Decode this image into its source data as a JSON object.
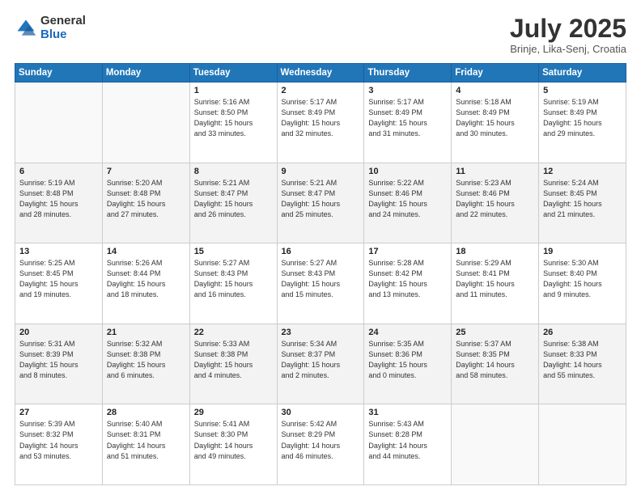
{
  "header": {
    "logo_general": "General",
    "logo_blue": "Blue",
    "month_title": "July 2025",
    "subtitle": "Brinje, Lika-Senj, Croatia"
  },
  "weekdays": [
    "Sunday",
    "Monday",
    "Tuesday",
    "Wednesday",
    "Thursday",
    "Friday",
    "Saturday"
  ],
  "weeks": [
    [
      {
        "day": "",
        "info": ""
      },
      {
        "day": "",
        "info": ""
      },
      {
        "day": "1",
        "info": "Sunrise: 5:16 AM\nSunset: 8:50 PM\nDaylight: 15 hours\nand 33 minutes."
      },
      {
        "day": "2",
        "info": "Sunrise: 5:17 AM\nSunset: 8:49 PM\nDaylight: 15 hours\nand 32 minutes."
      },
      {
        "day": "3",
        "info": "Sunrise: 5:17 AM\nSunset: 8:49 PM\nDaylight: 15 hours\nand 31 minutes."
      },
      {
        "day": "4",
        "info": "Sunrise: 5:18 AM\nSunset: 8:49 PM\nDaylight: 15 hours\nand 30 minutes."
      },
      {
        "day": "5",
        "info": "Sunrise: 5:19 AM\nSunset: 8:49 PM\nDaylight: 15 hours\nand 29 minutes."
      }
    ],
    [
      {
        "day": "6",
        "info": "Sunrise: 5:19 AM\nSunset: 8:48 PM\nDaylight: 15 hours\nand 28 minutes."
      },
      {
        "day": "7",
        "info": "Sunrise: 5:20 AM\nSunset: 8:48 PM\nDaylight: 15 hours\nand 27 minutes."
      },
      {
        "day": "8",
        "info": "Sunrise: 5:21 AM\nSunset: 8:47 PM\nDaylight: 15 hours\nand 26 minutes."
      },
      {
        "day": "9",
        "info": "Sunrise: 5:21 AM\nSunset: 8:47 PM\nDaylight: 15 hours\nand 25 minutes."
      },
      {
        "day": "10",
        "info": "Sunrise: 5:22 AM\nSunset: 8:46 PM\nDaylight: 15 hours\nand 24 minutes."
      },
      {
        "day": "11",
        "info": "Sunrise: 5:23 AM\nSunset: 8:46 PM\nDaylight: 15 hours\nand 22 minutes."
      },
      {
        "day": "12",
        "info": "Sunrise: 5:24 AM\nSunset: 8:45 PM\nDaylight: 15 hours\nand 21 minutes."
      }
    ],
    [
      {
        "day": "13",
        "info": "Sunrise: 5:25 AM\nSunset: 8:45 PM\nDaylight: 15 hours\nand 19 minutes."
      },
      {
        "day": "14",
        "info": "Sunrise: 5:26 AM\nSunset: 8:44 PM\nDaylight: 15 hours\nand 18 minutes."
      },
      {
        "day": "15",
        "info": "Sunrise: 5:27 AM\nSunset: 8:43 PM\nDaylight: 15 hours\nand 16 minutes."
      },
      {
        "day": "16",
        "info": "Sunrise: 5:27 AM\nSunset: 8:43 PM\nDaylight: 15 hours\nand 15 minutes."
      },
      {
        "day": "17",
        "info": "Sunrise: 5:28 AM\nSunset: 8:42 PM\nDaylight: 15 hours\nand 13 minutes."
      },
      {
        "day": "18",
        "info": "Sunrise: 5:29 AM\nSunset: 8:41 PM\nDaylight: 15 hours\nand 11 minutes."
      },
      {
        "day": "19",
        "info": "Sunrise: 5:30 AM\nSunset: 8:40 PM\nDaylight: 15 hours\nand 9 minutes."
      }
    ],
    [
      {
        "day": "20",
        "info": "Sunrise: 5:31 AM\nSunset: 8:39 PM\nDaylight: 15 hours\nand 8 minutes."
      },
      {
        "day": "21",
        "info": "Sunrise: 5:32 AM\nSunset: 8:38 PM\nDaylight: 15 hours\nand 6 minutes."
      },
      {
        "day": "22",
        "info": "Sunrise: 5:33 AM\nSunset: 8:38 PM\nDaylight: 15 hours\nand 4 minutes."
      },
      {
        "day": "23",
        "info": "Sunrise: 5:34 AM\nSunset: 8:37 PM\nDaylight: 15 hours\nand 2 minutes."
      },
      {
        "day": "24",
        "info": "Sunrise: 5:35 AM\nSunset: 8:36 PM\nDaylight: 15 hours\nand 0 minutes."
      },
      {
        "day": "25",
        "info": "Sunrise: 5:37 AM\nSunset: 8:35 PM\nDaylight: 14 hours\nand 58 minutes."
      },
      {
        "day": "26",
        "info": "Sunrise: 5:38 AM\nSunset: 8:33 PM\nDaylight: 14 hours\nand 55 minutes."
      }
    ],
    [
      {
        "day": "27",
        "info": "Sunrise: 5:39 AM\nSunset: 8:32 PM\nDaylight: 14 hours\nand 53 minutes."
      },
      {
        "day": "28",
        "info": "Sunrise: 5:40 AM\nSunset: 8:31 PM\nDaylight: 14 hours\nand 51 minutes."
      },
      {
        "day": "29",
        "info": "Sunrise: 5:41 AM\nSunset: 8:30 PM\nDaylight: 14 hours\nand 49 minutes."
      },
      {
        "day": "30",
        "info": "Sunrise: 5:42 AM\nSunset: 8:29 PM\nDaylight: 14 hours\nand 46 minutes."
      },
      {
        "day": "31",
        "info": "Sunrise: 5:43 AM\nSunset: 8:28 PM\nDaylight: 14 hours\nand 44 minutes."
      },
      {
        "day": "",
        "info": ""
      },
      {
        "day": "",
        "info": ""
      }
    ]
  ]
}
